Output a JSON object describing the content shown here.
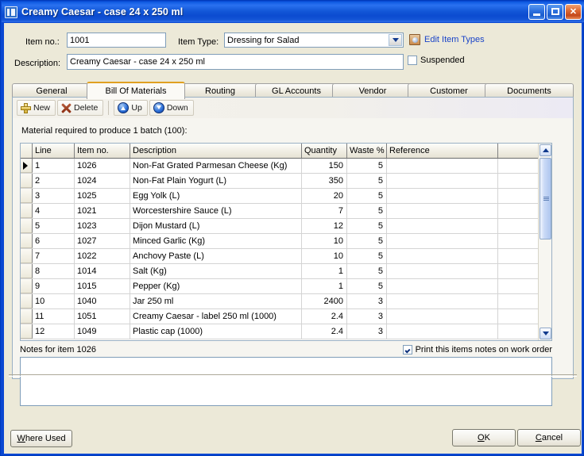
{
  "window": {
    "title": "Creamy Caesar - case 24 x 250 ml",
    "icon": "app-icon",
    "minimize_label": "Minimize",
    "maximize_label": "Maximize",
    "close_label": "Close"
  },
  "form": {
    "item_no_label": "Item no.:",
    "item_no_value": "1001",
    "item_type_label": "Item Type:",
    "item_type_value": "Dressing for Salad",
    "edit_item_types_link": "Edit Item Types",
    "description_label": "Description:",
    "description_value": "Creamy Caesar - case 24 x 250 ml",
    "suspended_label": "Suspended",
    "suspended_checked": false
  },
  "tabs": [
    {
      "label": "General",
      "active": false
    },
    {
      "label": "Bill Of Materials",
      "active": true
    },
    {
      "label": "Routing",
      "active": false
    },
    {
      "label": "GL Accounts",
      "active": false
    },
    {
      "label": "Vendor",
      "active": false
    },
    {
      "label": "Customer",
      "active": false
    },
    {
      "label": "Documents",
      "active": false
    }
  ],
  "toolbar": {
    "new_label": "New",
    "delete_label": "Delete",
    "up_label": "Up",
    "down_label": "Down"
  },
  "grid": {
    "hint": "Material required to produce 1 batch (100):",
    "columns": [
      "Line",
      "Item no.",
      "Description",
      "Quantity",
      "Waste %",
      "Reference"
    ],
    "rows": [
      {
        "line": "1",
        "item_no": "1026",
        "description": "Non-Fat Grated Parmesan Cheese (Kg)",
        "quantity": "150",
        "waste": "5",
        "reference": "",
        "selected": true
      },
      {
        "line": "2",
        "item_no": "1024",
        "description": "Non-Fat Plain Yogurt (L)",
        "quantity": "350",
        "waste": "5",
        "reference": "",
        "selected": false
      },
      {
        "line": "3",
        "item_no": "1025",
        "description": "Egg Yolk (L)",
        "quantity": "20",
        "waste": "5",
        "reference": "",
        "selected": false
      },
      {
        "line": "4",
        "item_no": "1021",
        "description": "Worcestershire Sauce (L)",
        "quantity": "7",
        "waste": "5",
        "reference": "",
        "selected": false
      },
      {
        "line": "5",
        "item_no": "1023",
        "description": "Dijon Mustard (L)",
        "quantity": "12",
        "waste": "5",
        "reference": "",
        "selected": false
      },
      {
        "line": "6",
        "item_no": "1027",
        "description": "Minced Garlic (Kg)",
        "quantity": "10",
        "waste": "5",
        "reference": "",
        "selected": false
      },
      {
        "line": "7",
        "item_no": "1022",
        "description": "Anchovy Paste (L)",
        "quantity": "10",
        "waste": "5",
        "reference": "",
        "selected": false
      },
      {
        "line": "8",
        "item_no": "1014",
        "description": "Salt (Kg)",
        "quantity": "1",
        "waste": "5",
        "reference": "",
        "selected": false
      },
      {
        "line": "9",
        "item_no": "1015",
        "description": "Pepper (Kg)",
        "quantity": "1",
        "waste": "5",
        "reference": "",
        "selected": false
      },
      {
        "line": "10",
        "item_no": "1040",
        "description": "Jar 250 ml",
        "quantity": "2400",
        "waste": "3",
        "reference": "",
        "selected": false
      },
      {
        "line": "11",
        "item_no": "1051",
        "description": "Creamy Caesar - label 250 ml (1000)",
        "quantity": "2.4",
        "waste": "3",
        "reference": "",
        "selected": false
      },
      {
        "line": "12",
        "item_no": "1049",
        "description": "Plastic cap (1000)",
        "quantity": "2.4",
        "waste": "3",
        "reference": "",
        "selected": false
      }
    ]
  },
  "notes": {
    "label": "Notes for item 1026",
    "print_checkbox_label": "Print this items notes on work order",
    "print_checked": true,
    "text": ""
  },
  "footer": {
    "where_used_label": "Where Used",
    "ok_label": "OK",
    "cancel_label": "Cancel"
  },
  "colors": {
    "titlebar_blue": "#0a57dd",
    "form_bg": "#ece9d8",
    "link_blue": "#1a44c8",
    "active_tab_accent": "#e0a020"
  }
}
